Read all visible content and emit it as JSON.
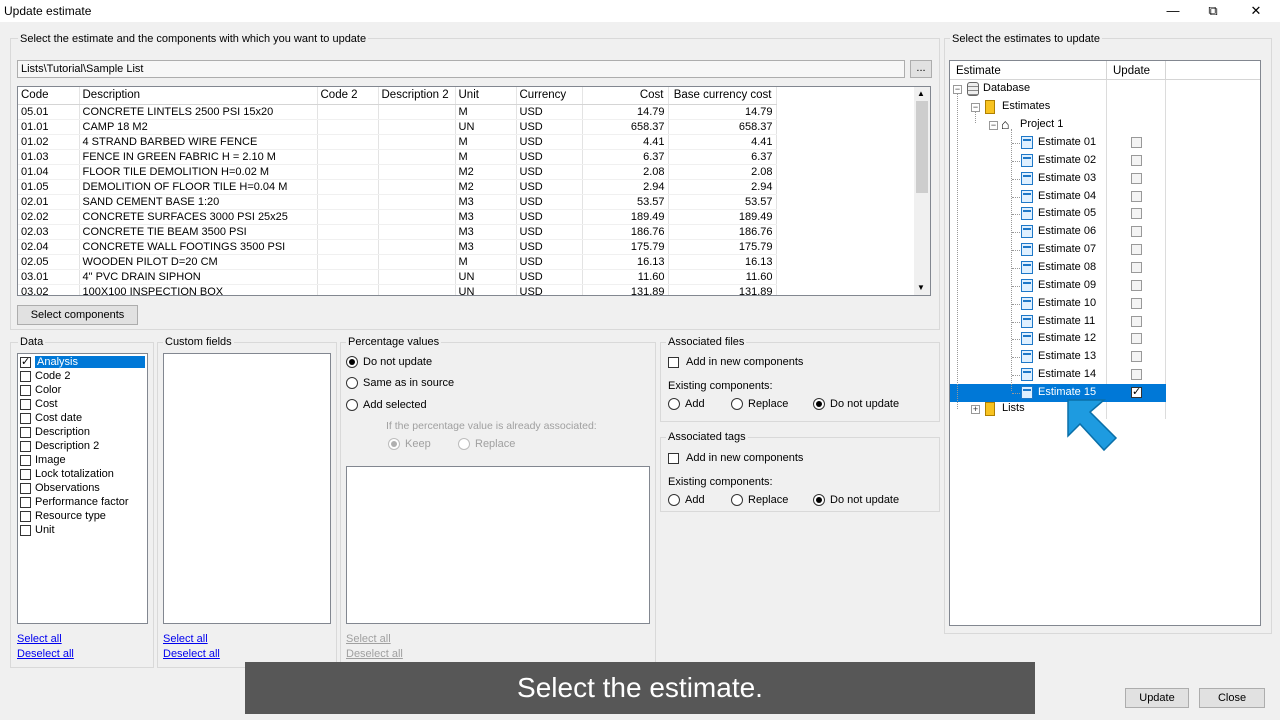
{
  "window": {
    "title": "Update estimate",
    "minimize": "—",
    "restore": "⧉",
    "close": "✕"
  },
  "left": {
    "instruction": "Select the estimate and the components with which you want to update",
    "path": "Lists\\Tutorial\\Sample List",
    "browse": "...",
    "columns": [
      "Code",
      "Description",
      "Code 2",
      "Description 2",
      "Unit",
      "Currency",
      "Cost",
      "Base currency cost"
    ],
    "rows": [
      [
        "05.01",
        "CONCRETE LINTELS 2500 PSI 15x20",
        "",
        "",
        "M",
        "USD",
        "14.79",
        "14.79"
      ],
      [
        "01.01",
        "CAMP 18 M2",
        "",
        "",
        "UN",
        "USD",
        "658.37",
        "658.37"
      ],
      [
        "01.02",
        "4 STRAND BARBED WIRE FENCE",
        "",
        "",
        "M",
        "USD",
        "4.41",
        "4.41"
      ],
      [
        "01.03",
        "FENCE IN GREEN FABRIC H = 2.10 M",
        "",
        "",
        "M",
        "USD",
        "6.37",
        "6.37"
      ],
      [
        "01.04",
        "FLOOR TILE DEMOLITION H=0.02 M",
        "",
        "",
        "M2",
        "USD",
        "2.08",
        "2.08"
      ],
      [
        "01.05",
        "DEMOLITION OF FLOOR TILE H=0.04 M",
        "",
        "",
        "M2",
        "USD",
        "2.94",
        "2.94"
      ],
      [
        "02.01",
        "SAND CEMENT BASE 1:20",
        "",
        "",
        "M3",
        "USD",
        "53.57",
        "53.57"
      ],
      [
        "02.02",
        "CONCRETE SURFACES 3000 PSI 25x25",
        "",
        "",
        "M3",
        "USD",
        "189.49",
        "189.49"
      ],
      [
        "02.03",
        "CONCRETE TIE BEAM 3500 PSI",
        "",
        "",
        "M3",
        "USD",
        "186.76",
        "186.76"
      ],
      [
        "02.04",
        "CONCRETE WALL FOOTINGS 3500 PSI",
        "",
        "",
        "M3",
        "USD",
        "175.79",
        "175.79"
      ],
      [
        "02.05",
        "WOODEN PILOT D=20 CM",
        "",
        "",
        "M",
        "USD",
        "16.13",
        "16.13"
      ],
      [
        "03.01",
        "4\" PVC DRAIN SIPHON",
        "",
        "",
        "UN",
        "USD",
        "11.60",
        "11.60"
      ],
      [
        "03.02",
        "100X100 INSPECTION BOX",
        "",
        "",
        "UN",
        "USD",
        "131.89",
        "131.89"
      ]
    ],
    "select_components": "Select components"
  },
  "data_group": {
    "label": "Data",
    "items": [
      {
        "label": "Analysis",
        "checked": true,
        "selected": true
      },
      {
        "label": "Code 2",
        "checked": false
      },
      {
        "label": "Color",
        "checked": false
      },
      {
        "label": "Cost",
        "checked": false
      },
      {
        "label": "Cost date",
        "checked": false
      },
      {
        "label": "Description",
        "checked": false
      },
      {
        "label": "Description 2",
        "checked": false
      },
      {
        "label": "Image",
        "checked": false
      },
      {
        "label": "Lock totalization",
        "checked": false
      },
      {
        "label": "Observations",
        "checked": false
      },
      {
        "label": "Performance factor",
        "checked": false
      },
      {
        "label": "Resource type",
        "checked": false
      },
      {
        "label": "Unit",
        "checked": false
      }
    ],
    "select_all": "Select all",
    "deselect_all": "Deselect all"
  },
  "custom_fields": {
    "label": "Custom fields",
    "select_all": "Select all",
    "deselect_all": "Deselect all"
  },
  "percentage": {
    "label": "Percentage values",
    "opt1": "Do not update",
    "opt2": "Same as in source",
    "opt3": "Add selected",
    "note": "If the percentage value is already associated:",
    "keep": "Keep",
    "replace": "Replace",
    "select_all": "Select all",
    "deselect_all": "Deselect all"
  },
  "assoc_files": {
    "label": "Associated files",
    "add_new": "Add in new components",
    "existing": "Existing components:",
    "add": "Add",
    "replace": "Replace",
    "no_update": "Do not update"
  },
  "assoc_tags": {
    "label": "Associated tags",
    "add_new": "Add in new components",
    "existing": "Existing components:",
    "add": "Add",
    "replace": "Replace",
    "no_update": "Do not update"
  },
  "right": {
    "label": "Select the estimates to update",
    "col_estimate": "Estimate",
    "col_update": "Update",
    "database": "Database",
    "estimates": "Estimates",
    "project": "Project 1",
    "items": [
      "Estimate 01",
      "Estimate 02",
      "Estimate 03",
      "Estimate 04",
      "Estimate 05",
      "Estimate 06",
      "Estimate 07",
      "Estimate 08",
      "Estimate 09",
      "Estimate 10",
      "Estimate 11",
      "Estimate 12",
      "Estimate 13",
      "Estimate 14",
      "Estimate 15"
    ],
    "checked_index": 14,
    "lists": "Lists"
  },
  "footer": {
    "update": "Update",
    "close": "Close"
  },
  "caption": "Select the estimate."
}
